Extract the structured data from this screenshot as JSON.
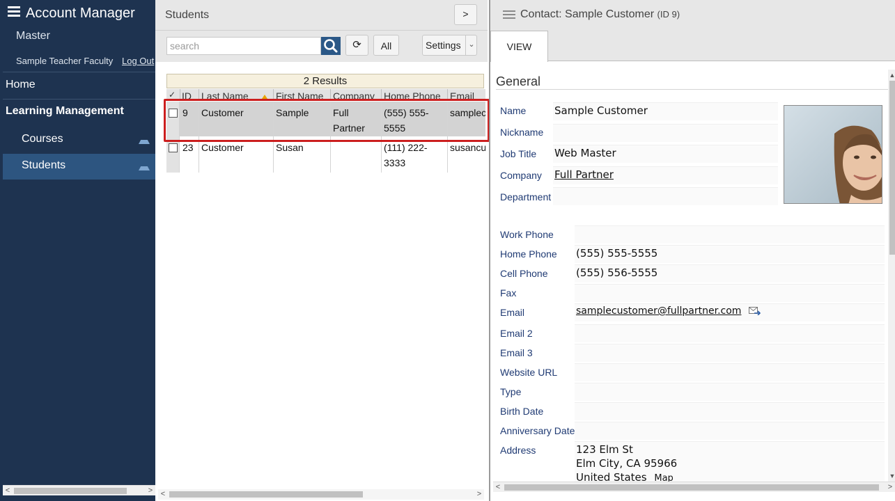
{
  "sidebar": {
    "title": "Account Manager",
    "master": "Master",
    "user": "Sample Teacher Faculty",
    "logout": "Log Out",
    "home": "Home",
    "section": "Learning Management",
    "items": [
      {
        "label": "Courses"
      },
      {
        "label": "Students"
      }
    ]
  },
  "list": {
    "title": "Students",
    "expand_label": ">",
    "search_placeholder": "search",
    "refresh_label": "⟳",
    "all_label": "All",
    "settings_label": "Settings",
    "results": "2 Results",
    "columns": [
      "✓",
      "ID",
      "Last Name",
      "First Name",
      "Company",
      "Home Phone",
      "Email"
    ],
    "rows": [
      {
        "id": "9",
        "last": "Customer",
        "first": "Sample",
        "company": "Full Partner",
        "phone": "(555) 555-5555",
        "email": "samplec"
      },
      {
        "id": "23",
        "last": "Customer",
        "first": "Susan",
        "company": "",
        "phone": "(111) 222-3333",
        "email": "susancu"
      }
    ]
  },
  "detail": {
    "title": "Contact: Sample Customer",
    "id_label": "(ID 9)",
    "tab": "VIEW",
    "section": "General",
    "fields": {
      "name": {
        "label": "Name",
        "value": "Sample Customer"
      },
      "nickname": {
        "label": "Nickname",
        "value": ""
      },
      "job_title": {
        "label": "Job Title",
        "value": "Web Master"
      },
      "company": {
        "label": "Company",
        "value": "Full Partner"
      },
      "department": {
        "label": "Department",
        "value": ""
      },
      "work_phone": {
        "label": "Work Phone",
        "value": ""
      },
      "home_phone": {
        "label": "Home Phone",
        "value": "(555) 555-5555"
      },
      "cell_phone": {
        "label": "Cell Phone",
        "value": "(555) 556-5555"
      },
      "fax": {
        "label": "Fax",
        "value": ""
      },
      "email": {
        "label": "Email",
        "value": "samplecustomer@fullpartner.com"
      },
      "email2": {
        "label": "Email 2",
        "value": ""
      },
      "email3": {
        "label": "Email 3",
        "value": ""
      },
      "website": {
        "label": "Website URL",
        "value": ""
      },
      "type": {
        "label": "Type",
        "value": ""
      },
      "birth_date": {
        "label": "Birth Date",
        "value": ""
      },
      "anniversary": {
        "label": "Anniversary Date",
        "value": ""
      },
      "address": {
        "label": "Address",
        "line1": "123 Elm St",
        "line2": "Elm City, CA 95966",
        "line3": "United States",
        "map": "Map"
      }
    }
  },
  "icons": [
    "menu-icon",
    "search-icon",
    "refresh-icon",
    "chevron-down-icon",
    "collapse-icon",
    "mail-forward-icon"
  ],
  "colors": {
    "sidebar": "#1e3350",
    "sidebar_active": "#2d5580",
    "highlight": "#cc1f1f",
    "search_button": "#2b5887",
    "label": "#1f3a73"
  }
}
